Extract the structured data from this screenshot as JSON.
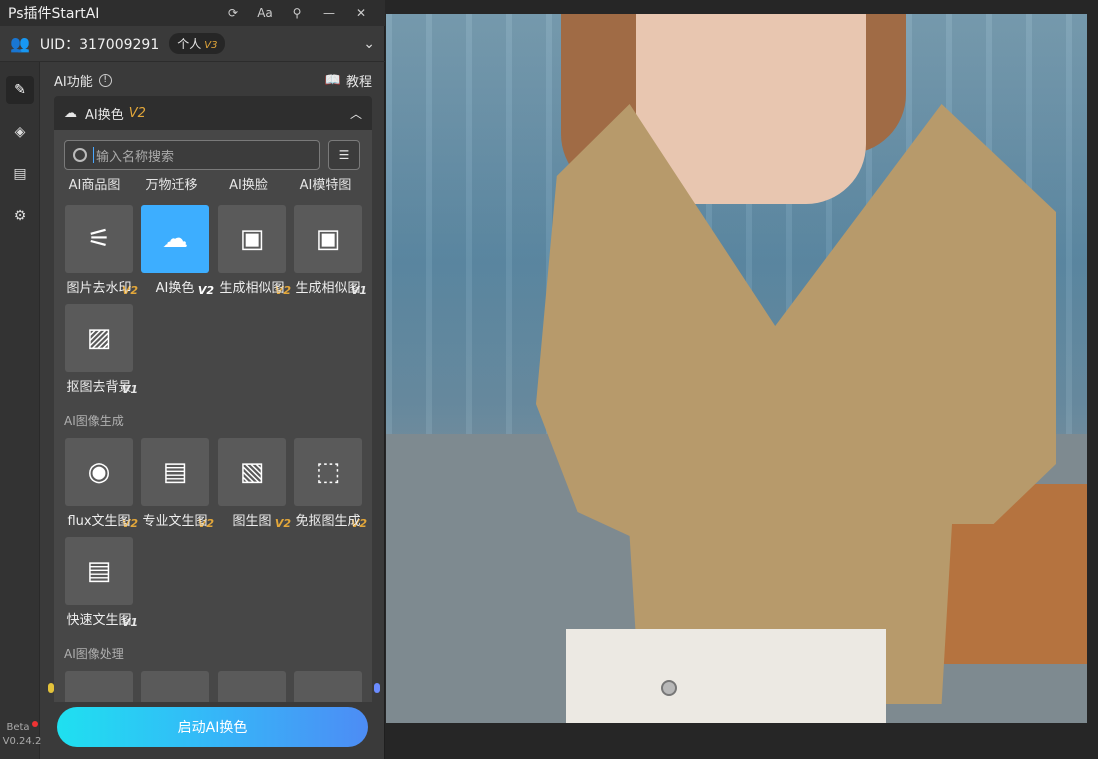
{
  "window": {
    "title": "Ps插件StartAI",
    "buttons": [
      "refresh-icon",
      "font-icon",
      "pin-icon",
      "minimize-icon",
      "close-icon"
    ],
    "font_label": "Aa"
  },
  "user": {
    "uid_label": "UID：317009291",
    "plan": "个人",
    "plan_level": "V3"
  },
  "nav": [
    "edit-icon",
    "layers-icon",
    "clipboard-icon",
    "gear-icon"
  ],
  "version": {
    "beta": "Beta",
    "number": "V0.24.2"
  },
  "section": {
    "title": "AI功能",
    "tutorial": "教程"
  },
  "selected_tool": {
    "label": "AI换色",
    "version": "V2"
  },
  "search": {
    "placeholder": "输入名称搜索"
  },
  "categories": [
    "AI商品图",
    "万物迁移",
    "AI换脸",
    "AI模特图"
  ],
  "group1": {
    "tiles": [
      {
        "label": "图片去水印",
        "version": "V2",
        "icon": "no-watermark-icon",
        "glyph": "⚟"
      },
      {
        "label": "AI换色",
        "version": "V2",
        "icon": "color-change-icon",
        "glyph": "☁"
      },
      {
        "label": "生成相似图",
        "version": "V2",
        "icon": "image-sparkle-icon",
        "glyph": "▣"
      },
      {
        "label": "生成相似图",
        "version": "V1",
        "icon": "image-sparkle-icon",
        "glyph": "▣"
      },
      {
        "label": "抠图去背景",
        "version": "V1",
        "icon": "hatch-icon",
        "glyph": "▨"
      }
    ]
  },
  "group2": {
    "title": "AI图像生成",
    "tiles": [
      {
        "label": "flux文生图",
        "version": "V2",
        "icon": "flux-icon",
        "glyph": "◉"
      },
      {
        "label": "专业文生图",
        "version": "V2",
        "icon": "image-text-icon",
        "glyph": "▤"
      },
      {
        "label": "图生图",
        "version": "V2",
        "icon": "image-to-image-icon",
        "glyph": "▧"
      },
      {
        "label": "免抠图生成",
        "version": "V2",
        "icon": "crop-image-icon",
        "glyph": "⬚"
      },
      {
        "label": "快速文生图",
        "version": "V1",
        "icon": "image-text-icon",
        "glyph": "▤"
      }
    ]
  },
  "group3": {
    "title": "AI图像处理"
  },
  "action": {
    "label": "启动AI换色"
  },
  "colors": {
    "accent": "#3daeff",
    "version_tag": "#e3a73a",
    "panel": "#3a3a3a"
  }
}
